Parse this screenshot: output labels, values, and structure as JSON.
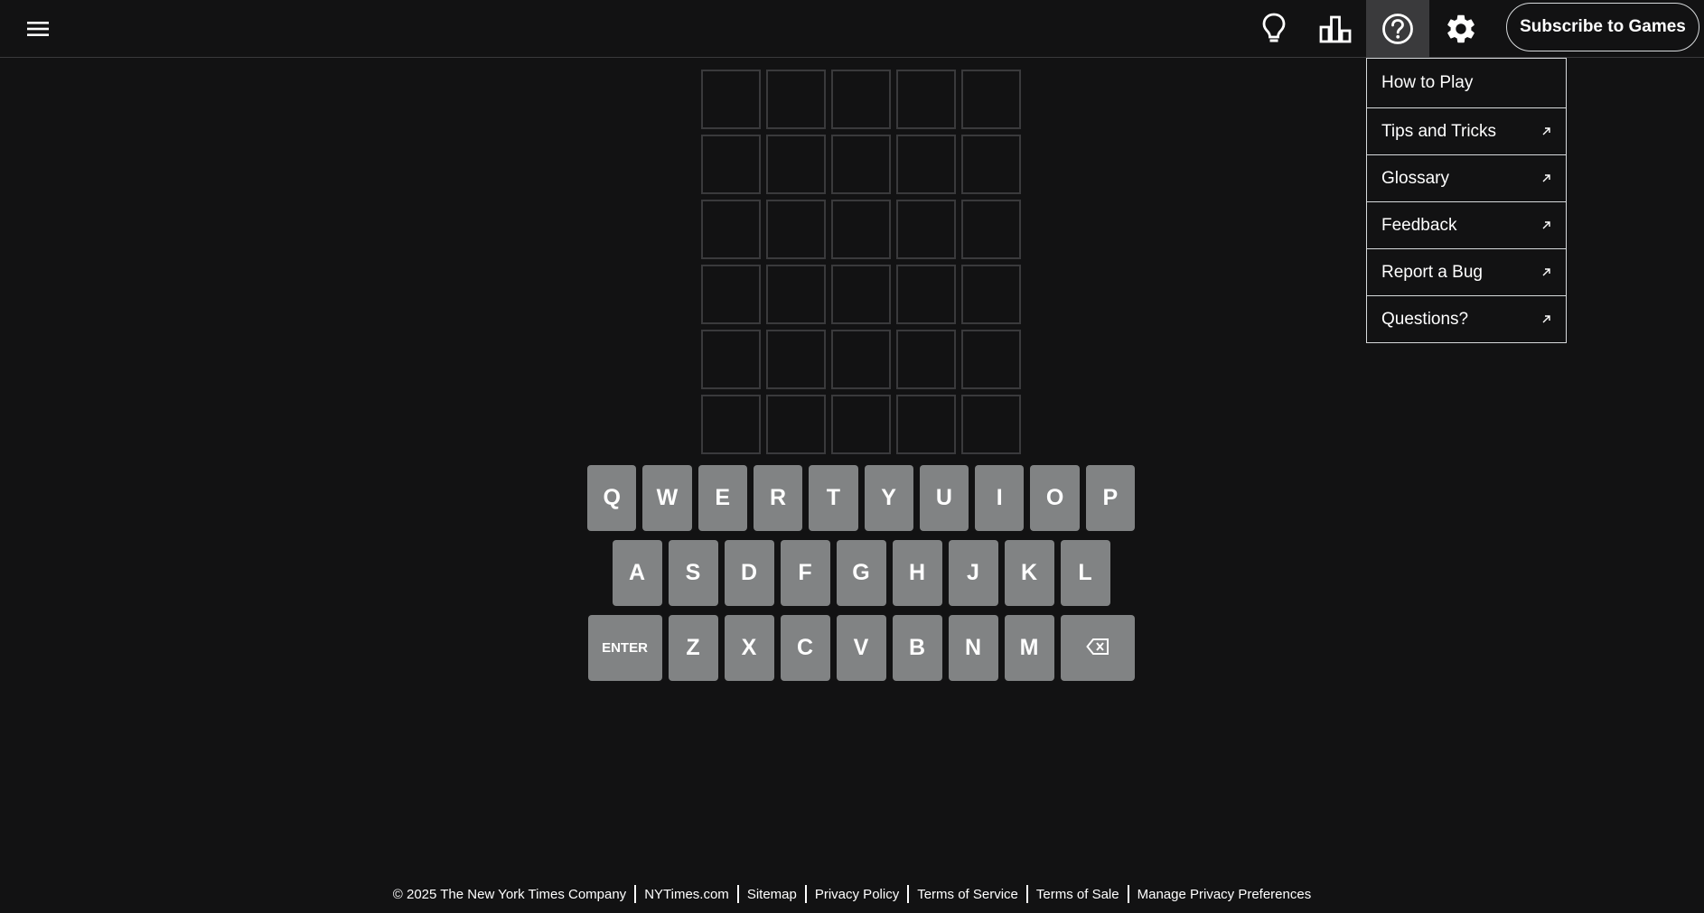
{
  "header": {
    "icons": [
      "menu-icon",
      "lightbulb-icon",
      "stats-icon",
      "help-icon",
      "gear-icon"
    ],
    "subscribe_label": "Subscribe to Games"
  },
  "help_menu": {
    "items": [
      {
        "label": "How to Play",
        "external": false
      },
      {
        "label": "Tips and Tricks",
        "external": true
      },
      {
        "label": "Glossary",
        "external": true
      },
      {
        "label": "Feedback",
        "external": true
      },
      {
        "label": "Report a Bug",
        "external": true
      },
      {
        "label": "Questions?",
        "external": true
      }
    ]
  },
  "board": {
    "rows": 6,
    "cols": 5,
    "tiles": [
      [
        "",
        "",
        "",
        "",
        ""
      ],
      [
        "",
        "",
        "",
        "",
        ""
      ],
      [
        "",
        "",
        "",
        "",
        ""
      ],
      [
        "",
        "",
        "",
        "",
        ""
      ],
      [
        "",
        "",
        "",
        "",
        ""
      ],
      [
        "",
        "",
        "",
        "",
        ""
      ]
    ]
  },
  "keyboard": {
    "rows": [
      [
        "Q",
        "W",
        "E",
        "R",
        "T",
        "Y",
        "U",
        "I",
        "O",
        "P"
      ],
      [
        "A",
        "S",
        "D",
        "F",
        "G",
        "H",
        "J",
        "K",
        "L"
      ],
      [
        "ENTER",
        "Z",
        "X",
        "C",
        "V",
        "B",
        "N",
        "M",
        "backspace-icon"
      ]
    ]
  },
  "footer": {
    "copyright": "© 2025 The New York Times Company",
    "links": [
      "NYTimes.com",
      "Sitemap",
      "Privacy Policy",
      "Terms of Service",
      "Terms of Sale",
      "Manage Privacy Preferences"
    ]
  },
  "colors": {
    "background": "#121213",
    "tile_border": "#3a3a3c",
    "key_bg": "#818384",
    "menu_border": "#d7dadc"
  }
}
